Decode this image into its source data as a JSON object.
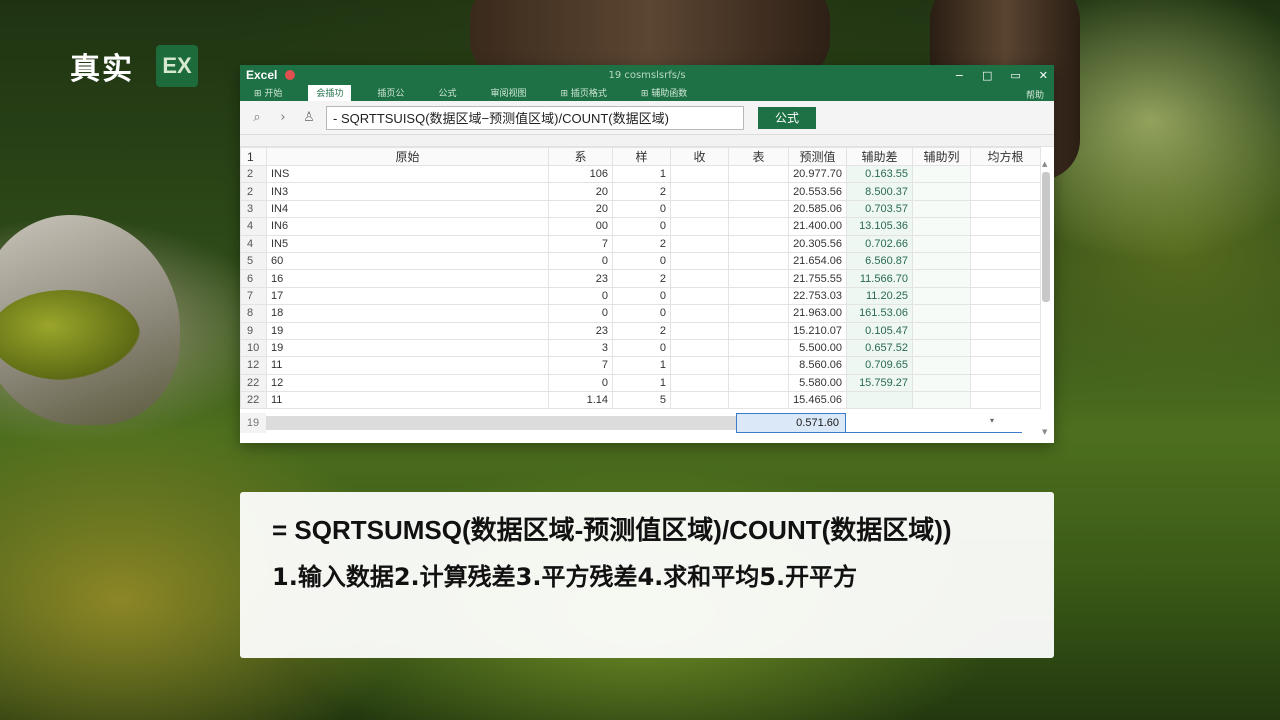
{
  "brand": {
    "text": "真实",
    "badge": "EX"
  },
  "window": {
    "app_name": "Excel",
    "doc_title": "19 cosmslsrfs/s",
    "controls": {
      "minimize": "−",
      "restore": "□",
      "maximize": "▭",
      "close": "✕"
    },
    "ribbon_tabs": [
      "⊞ 开始",
      "会插功",
      "插页公",
      "公式",
      "审阅视图",
      "⊞ 插页格式",
      "⊞ 辅助函数"
    ],
    "ribbon_active_index": 1,
    "help": "帮助",
    "formula_bar": {
      "value": "- SQRTTSUISQ(数据区域−预测值区域)/COUNT(数据区域)",
      "button": "公式"
    },
    "columns": [
      "1",
      "原始",
      "系",
      "样",
      "收",
      "表",
      "预测值",
      "辅助差",
      "辅助列",
      "均方根"
    ],
    "rows": [
      {
        "rn": "2",
        "a": "INS",
        "b": "106",
        "c": "1",
        "d": "",
        "e": "",
        "pred": "20.977.70",
        "aux1": "0.163.55"
      },
      {
        "rn": "2",
        "a": "IN3",
        "b": "20",
        "c": "2",
        "d": "",
        "e": "",
        "pred": "20.553.56",
        "aux1": "8.500.37"
      },
      {
        "rn": "3",
        "a": "IN4",
        "b": "20",
        "c": "0",
        "d": "",
        "e": "",
        "pred": "20.585.06",
        "aux1": "0.703.57"
      },
      {
        "rn": "4",
        "a": "IN6",
        "b": "00",
        "c": "0",
        "d": "",
        "e": "",
        "pred": "21.400.00",
        "aux1": "13.105.36"
      },
      {
        "rn": "4",
        "a": "IN5",
        "b": "7",
        "c": "2",
        "d": "",
        "e": "",
        "pred": "20.305.56",
        "aux1": "0.702.66"
      },
      {
        "rn": "5",
        "a": "60",
        "b": "0",
        "c": "0",
        "d": "",
        "e": "",
        "pred": "21.654.06",
        "aux1": "6.560.87"
      },
      {
        "rn": "6",
        "a": "16",
        "b": "23",
        "c": "2",
        "d": "",
        "e": "",
        "pred": "21.755.55",
        "aux1": "11.566.70"
      },
      {
        "rn": "7",
        "a": "17",
        "b": "0",
        "c": "0",
        "d": "",
        "e": "",
        "pred": "22.753.03",
        "aux1": "11.20.25"
      },
      {
        "rn": "8",
        "a": "18",
        "b": "0",
        "c": "0",
        "d": "",
        "e": "",
        "pred": "21.963.00",
        "aux1": "161.53.06"
      },
      {
        "rn": "9",
        "a": "19",
        "b": "23",
        "c": "2",
        "d": "",
        "e": "",
        "pred": "15.210.07",
        "aux1": "0.105.47"
      },
      {
        "rn": "10",
        "a": "19",
        "b": "3",
        "c": "0",
        "d": "",
        "e": "",
        "pred": "5.500.00",
        "aux1": "0.657.52"
      },
      {
        "rn": "12",
        "a": "11",
        "b": "7",
        "c": "1",
        "d": "",
        "e": "",
        "pred": "8.560.06",
        "aux1": "0.709.65"
      },
      {
        "rn": "22",
        "a": "12",
        "b": "0",
        "c": "1",
        "d": "",
        "e": "",
        "pred": "5.580.00",
        "aux1": "15.759.27"
      },
      {
        "rn": "22",
        "a": "11",
        "b": "1.14",
        "c": "5",
        "d": "",
        "e": "",
        "pred": "15.465.06",
        "aux1": ""
      }
    ],
    "status": {
      "row": "19",
      "result": "0.571.60",
      "marker": "▾"
    },
    "icons": {
      "search": "search-icon",
      "next": "chevron-right-icon",
      "user": "user-icon",
      "dropdown": "chevron-down-icon"
    }
  },
  "caption": {
    "line1": "= SQRTSUMSQ(数据区域-预测值区域)/COUNT(数据区域))",
    "line2": "1.输入数据2.计算残差3.平方残差4.求和平均5.开平方"
  }
}
